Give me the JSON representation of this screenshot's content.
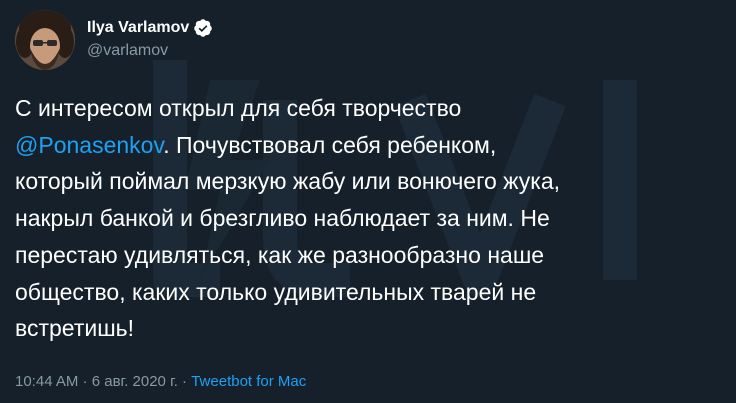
{
  "user": {
    "display_name": "Ilya Varlamov",
    "handle": "@varlamov"
  },
  "tweet": {
    "mention": "@Ponasenkov",
    "lines": {
      "l1": "С интересом открыл для себя творчество",
      "l2_rest": ". Почувствовал себя ребенком,",
      "l3": "который поймал мерзкую жабу или вонючего жука,",
      "l4": "накрыл банкой и брезгливо наблюдает за ним. Не",
      "l5": "перестаю удивляться, как же разнообразно наше",
      "l6": "общество, каких только удивительных тварей не",
      "l7": "встретишь!"
    }
  },
  "meta": {
    "time": "10:44 AM",
    "separator1": " · ",
    "date": "6 авг. 2020 г.",
    "separator2": " · ",
    "source": "Tweetbot for Mac"
  },
  "colors": {
    "background": "#15202b",
    "text": "#ffffff",
    "secondary": "#8899a6",
    "link": "#1da1f2"
  }
}
